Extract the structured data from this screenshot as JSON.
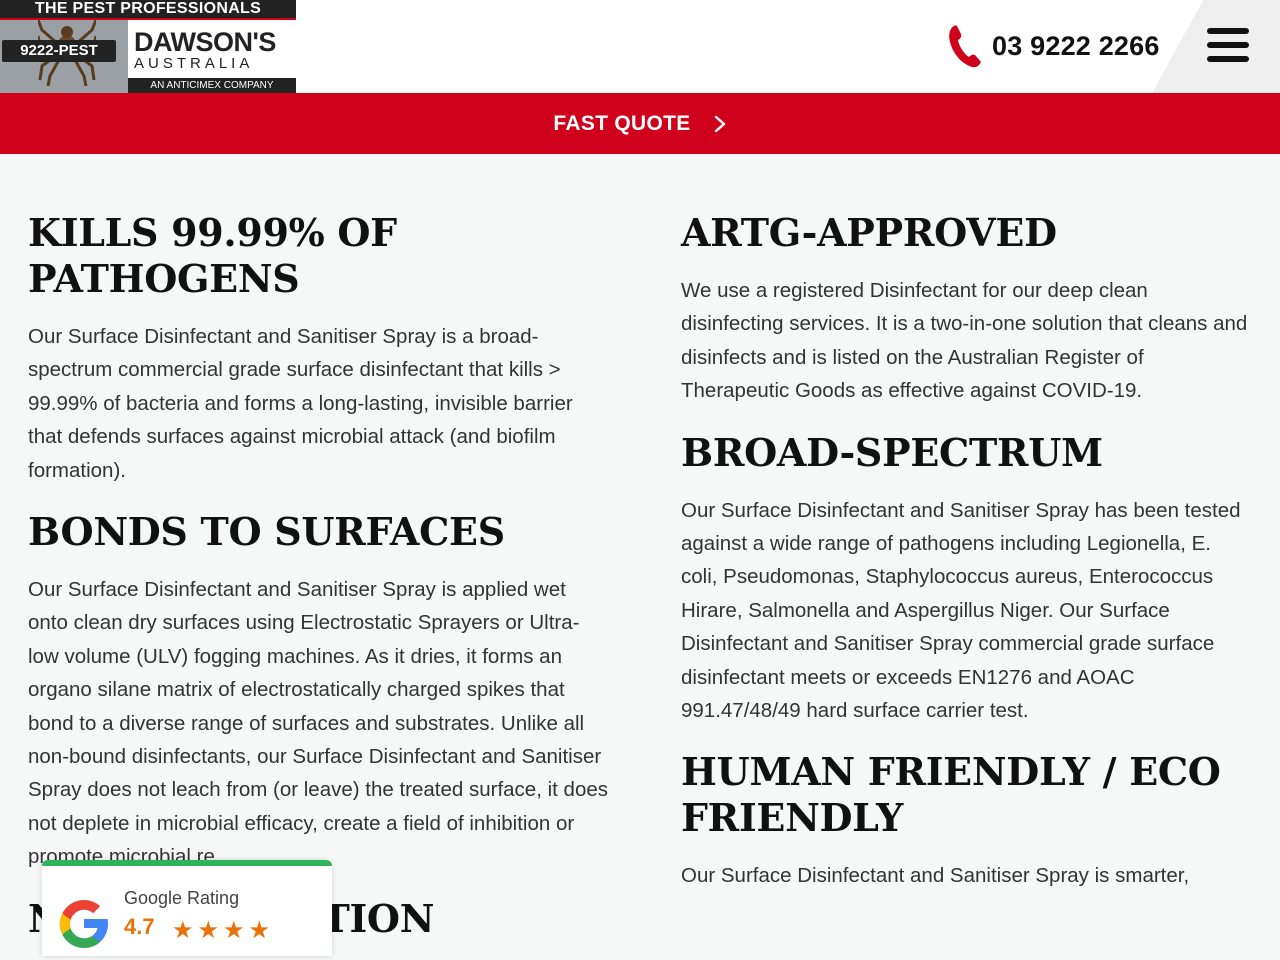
{
  "header": {
    "logo": {
      "tagline": "THE PEST PROFESSIONALS",
      "phone_badge": "9222-PEST",
      "brand": "DAWSON'S",
      "country": "AUSTRALIA",
      "sub": "AN ANTICIMEX COMPANY"
    },
    "phone_number": "03 9222 2266"
  },
  "quote_bar": {
    "label": "FAST QUOTE"
  },
  "sections_left": [
    {
      "heading": "KILLS 99.99% OF PATHOGENS",
      "body": "Our Surface Disinfectant and Sanitiser Spray is a broad-spectrum commercial grade surface disinfectant that kills > 99.99% of bacteria and forms a long-lasting, invisible barrier that defends surfaces against microbial attack (and biofilm formation)."
    },
    {
      "heading": "BONDS TO SURFACES",
      "body": "Our Surface Disinfectant and Sanitiser Spray is applied wet onto clean dry surfaces using Electrostatic Sprayers or Ultra-low volume (ULV) fogging machines. As it dries, it forms an organo silane matrix of electrostatically charged spikes that bond to a diverse range of surfaces and substrates. Unlike all non-bound disinfectants, our Surface Disinfectant and Sanitiser Spray does not leach from (or leave) the treated surface, it does not deplete in microbial efficacy, create a field of inhibition or promote microbial re"
    },
    {
      "heading": "NO RE-INFECTION",
      "body": ""
    }
  ],
  "sections_right": [
    {
      "heading": "ARTG-APPROVED",
      "body": "We use a registered Disinfectant for our deep clean disinfecting services. It is a two-in-one solution that cleans and disinfects and is listed on the Australian Register of Therapeutic Goods as effective against COVID-19."
    },
    {
      "heading": "BROAD-SPECTRUM",
      "body": "Our Surface Disinfectant and Sanitiser Spray has been tested against a wide range of pathogens including Legionella, E. coli, Pseudomonas, Staphylococcus aureus, Enterococcus Hirare, Salmonella and Aspergillus Niger. Our Surface Disinfectant and Sanitiser Spray commercial grade surface disinfectant meets or exceeds EN1276 and AOAC 991.47/48/49 hard surface carrier test."
    },
    {
      "heading": "HUMAN FRIENDLY / ECO FRIENDLY",
      "body": "Our Surface Disinfectant and Sanitiser Spray is smarter,"
    }
  ],
  "google_badge": {
    "title": "Google Rating",
    "score": "4.7",
    "stars": "★★★★",
    "accent": "#2fb35a"
  },
  "colors": {
    "brand_red": "#d0021b",
    "text": "#333333",
    "heading": "#111111"
  },
  "icons": [
    "phone-icon",
    "hamburger-menu-icon",
    "chevron-right-icon",
    "google-g-icon",
    "star-icon"
  ]
}
